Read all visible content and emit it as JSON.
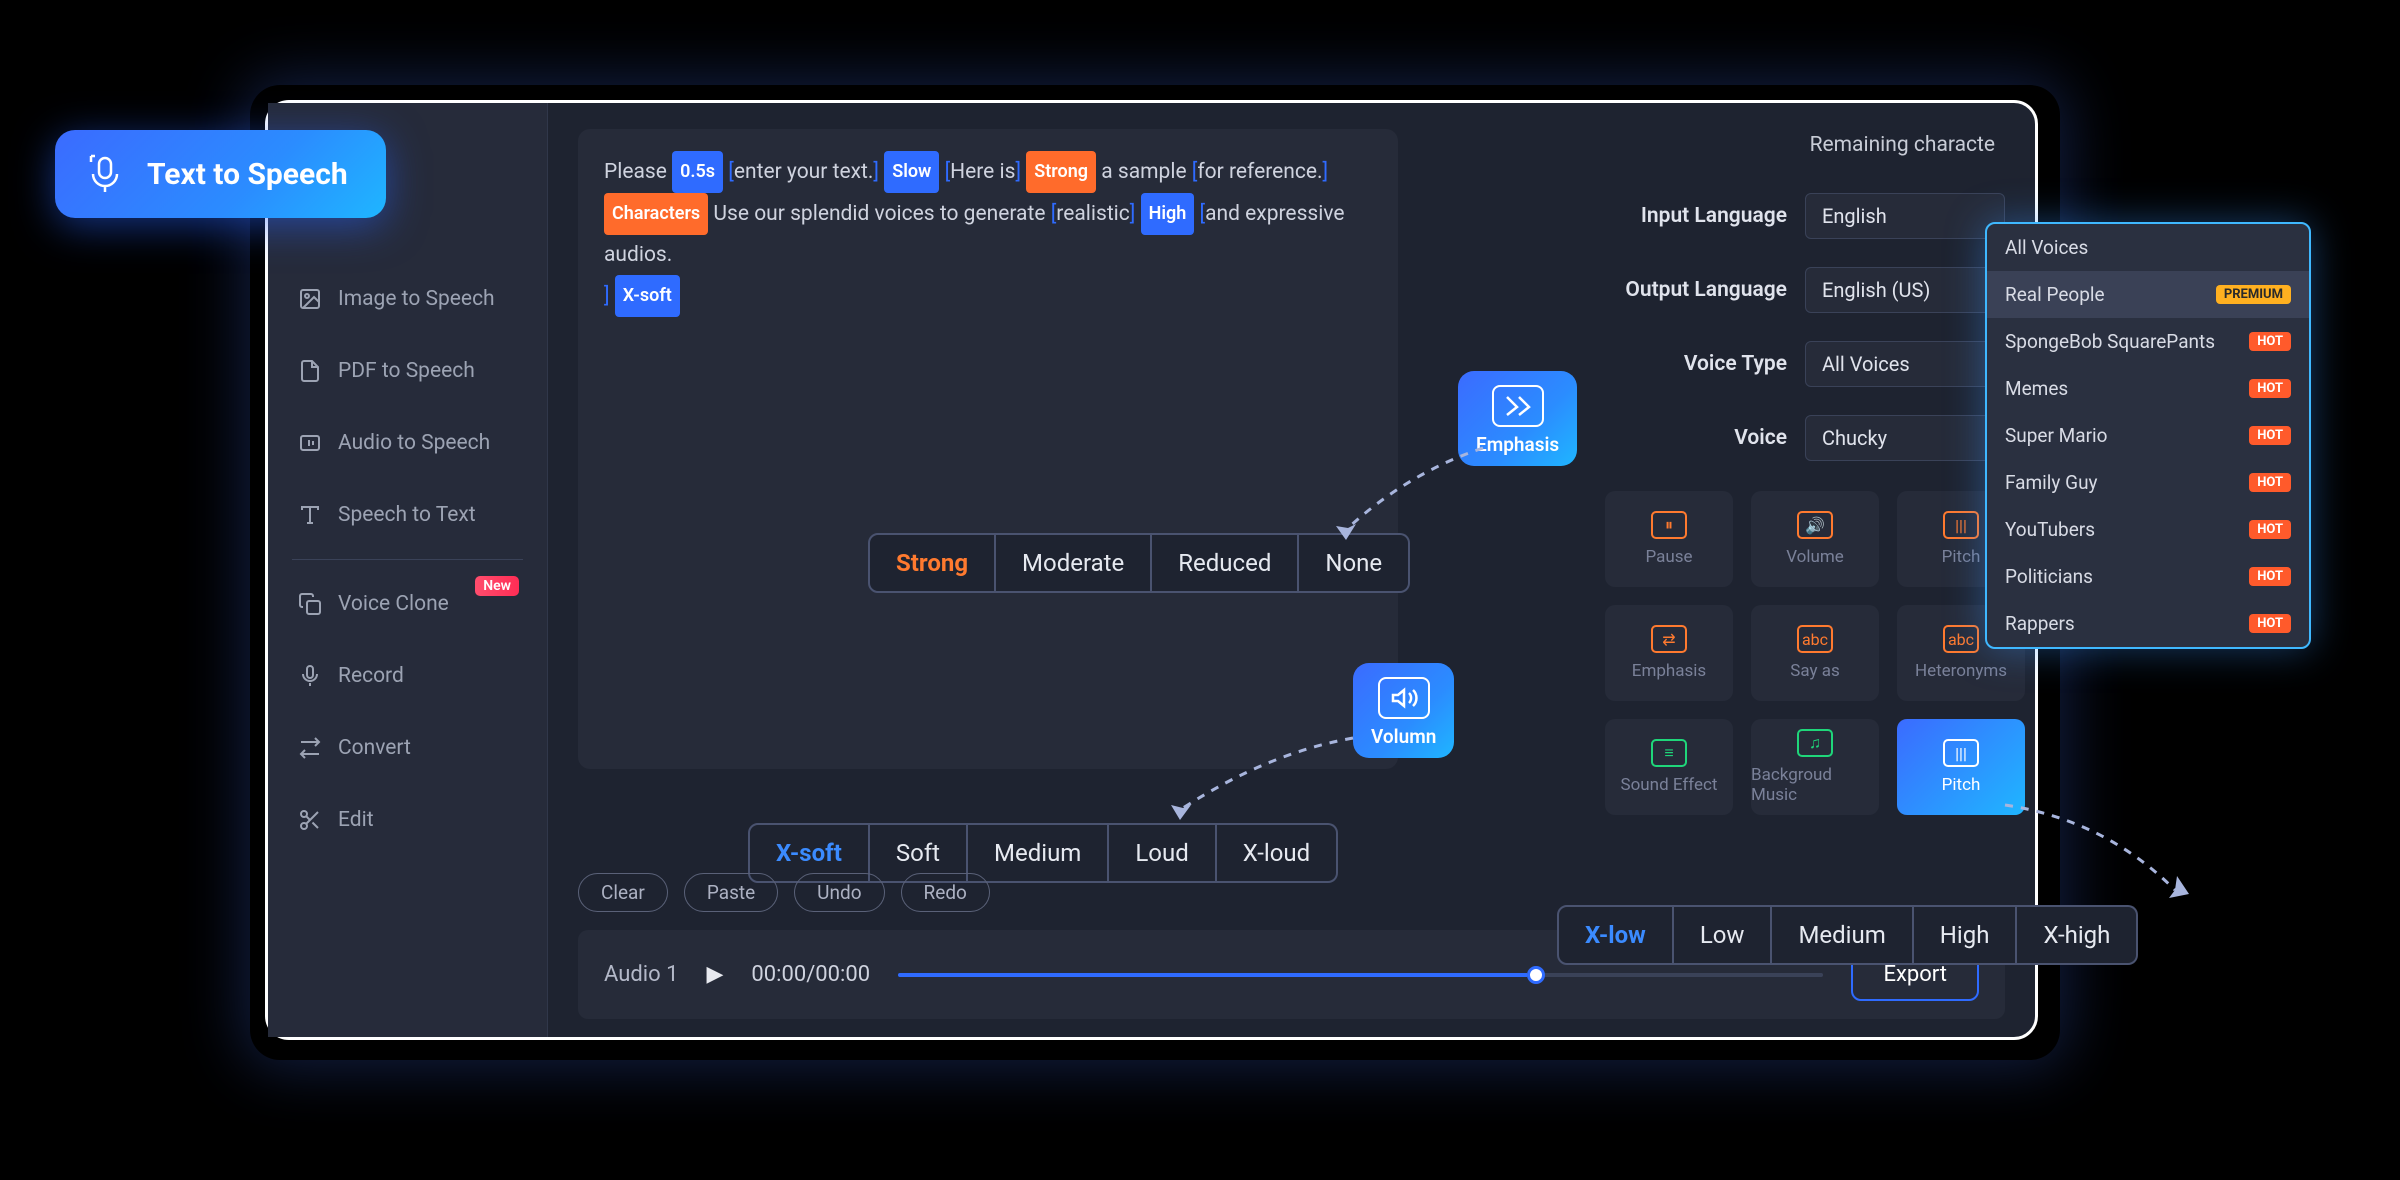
{
  "tts_pill": "Text  to Speech",
  "sidebar": {
    "items": [
      {
        "label": "Image to Speech"
      },
      {
        "label": "PDF to Speech"
      },
      {
        "label": "Audio to Speech"
      },
      {
        "label": "Speech to Text"
      },
      {
        "label": "Voice Clone",
        "badge": "New"
      },
      {
        "label": "Record"
      },
      {
        "label": "Convert"
      },
      {
        "label": "Edit"
      }
    ]
  },
  "remaining": "Remaining characte",
  "textbox": {
    "t0": "Please ",
    "tag0": "0.5s",
    "t1": "enter your text.",
    "tag1": "Slow",
    "t2": "Here is",
    "tag2": "Strong",
    "t3": " a sample ",
    "t4": "for reference.",
    "tag3": "Characters",
    "t5": " Use our splendid voices to generate ",
    "t6": "realistic",
    "tag4": "High",
    "t7": "and expressive audios.",
    "tag5": "X-soft"
  },
  "emphasis": {
    "badge": "Emphasis",
    "opts": [
      "Strong",
      "Moderate",
      "Reduced",
      "None"
    ],
    "active": 0
  },
  "volume": {
    "badge": "Volumn",
    "opts": [
      "X-soft",
      "Soft",
      "Medium",
      "Loud",
      "X-loud"
    ],
    "active": 0
  },
  "pitch": {
    "badge": "Pitch",
    "opts": [
      "X-low",
      "Low",
      "Medium",
      "High",
      "X-high"
    ],
    "active": 0
  },
  "fields": {
    "input_lang": {
      "label": "Input Language",
      "value": "English"
    },
    "output_lang": {
      "label": "Output Language",
      "value": "English (US)"
    },
    "voice_type": {
      "label": "Voice Type",
      "value": "All Voices"
    },
    "voice": {
      "label": "Voice",
      "value": "Chucky"
    }
  },
  "tools": [
    "Pause",
    "Volume",
    "Pitch",
    "Emphasis",
    "Say as",
    "Heteronyms",
    "Sound Effect",
    "Backgroud Music",
    "Pitch"
  ],
  "dropdown": [
    {
      "label": "All Voices"
    },
    {
      "label": "Real People",
      "badge": "PREMIUM",
      "selected": true
    },
    {
      "label": "SpongeBob SquarePants",
      "badge": "HOT"
    },
    {
      "label": "Memes",
      "badge": "HOT"
    },
    {
      "label": "Super Mario",
      "badge": "HOT"
    },
    {
      "label": "Family Guy",
      "badge": "HOT"
    },
    {
      "label": "YouTubers",
      "badge": "HOT"
    },
    {
      "label": "Politicians",
      "badge": "HOT"
    },
    {
      "label": "Rappers",
      "badge": "HOT"
    }
  ],
  "actions": [
    "Clear",
    "Paste",
    "Undo",
    "Redo"
  ],
  "player": {
    "label": "Audio 1",
    "time": "00:00/00:00",
    "export": "Export"
  }
}
